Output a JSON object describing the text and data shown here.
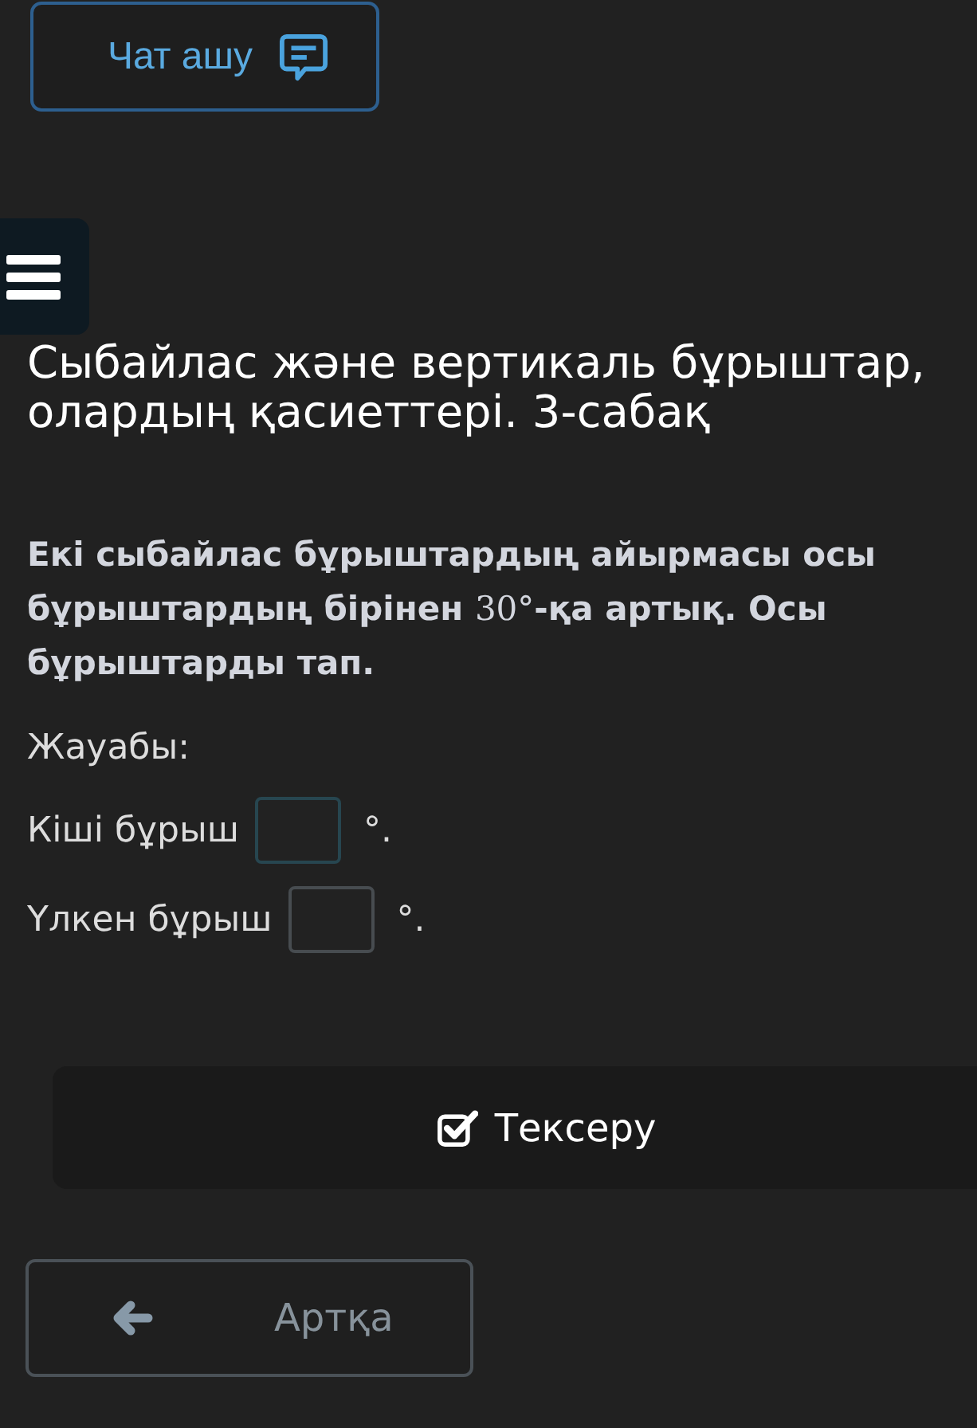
{
  "chat_button": {
    "label": "Чат ашу"
  },
  "lesson_title": "Сыбайлас және вертикаль бұрыштар, олардың қасиеттері. 3-сабақ",
  "question": [
    {
      "kind": "text",
      "text": "Екі сыбайлас бұрыштардың айырмасы осы бұрыштардың бірінен "
    },
    {
      "kind": "math",
      "text": "30°"
    },
    {
      "kind": "text",
      "text": "-қа артық. Осы бұрыштарды тап."
    }
  ],
  "answer_label": "Жауабы:",
  "answers": [
    {
      "label": "Кіші бұрыш",
      "focused": true,
      "unit": "°."
    },
    {
      "label": "Үлкен бұрыш",
      "focused": false,
      "unit": "°."
    }
  ],
  "check_button": {
    "label": "Тексеру"
  },
  "back_button": {
    "label": "Артқа"
  }
}
